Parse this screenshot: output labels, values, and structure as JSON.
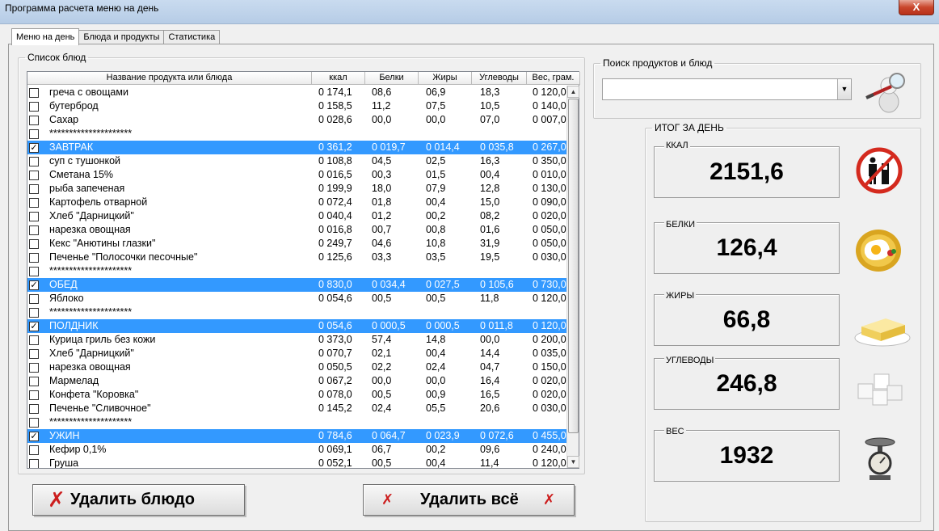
{
  "window": {
    "title": "Программа расчета меню на день",
    "close_label": "X"
  },
  "tabs": [
    {
      "label": "Меню на день"
    },
    {
      "label": "Блюда и продукты"
    },
    {
      "label": "Статистика"
    }
  ],
  "dish_list": {
    "group_title": "Список блюд",
    "columns": [
      "Название продукта или блюда",
      "ккал",
      "Белки",
      "Жиры",
      "Углеводы",
      "Вес, грам."
    ],
    "rows": [
      {
        "checked": false,
        "selected": false,
        "name": "греча с овощами",
        "kcal": "0 174,1",
        "protein": "08,6",
        "fat": "06,9",
        "carbs": "18,3",
        "weight": "0 120,0"
      },
      {
        "checked": false,
        "selected": false,
        "name": "бутерброд",
        "kcal": "0 158,5",
        "protein": "11,2",
        "fat": "07,5",
        "carbs": "10,5",
        "weight": "0 140,0"
      },
      {
        "checked": false,
        "selected": false,
        "name": "Сахар",
        "kcal": "0 028,6",
        "protein": "00,0",
        "fat": "00,0",
        "carbs": "07,0",
        "weight": "0 007,0"
      },
      {
        "checked": false,
        "selected": false,
        "name": "*********************",
        "kcal": "",
        "protein": "",
        "fat": "",
        "carbs": "",
        "weight": ""
      },
      {
        "checked": true,
        "selected": true,
        "name": "ЗАВТРАК",
        "kcal": "0 361,2",
        "protein": "0 019,7",
        "fat": "0 014,4",
        "carbs": "0 035,8",
        "weight": "0 267,0"
      },
      {
        "checked": false,
        "selected": false,
        "name": "суп с тушонкой",
        "kcal": "0 108,8",
        "protein": "04,5",
        "fat": "02,5",
        "carbs": "16,3",
        "weight": "0 350,0"
      },
      {
        "checked": false,
        "selected": false,
        "name": "Сметана 15%",
        "kcal": "0 016,5",
        "protein": "00,3",
        "fat": "01,5",
        "carbs": "00,4",
        "weight": "0 010,0"
      },
      {
        "checked": false,
        "selected": false,
        "name": "рыба запеченая",
        "kcal": "0 199,9",
        "protein": "18,0",
        "fat": "07,9",
        "carbs": "12,8",
        "weight": "0 130,0"
      },
      {
        "checked": false,
        "selected": false,
        "name": "Картофель отварной",
        "kcal": "0 072,4",
        "protein": "01,8",
        "fat": "00,4",
        "carbs": "15,0",
        "weight": "0 090,0"
      },
      {
        "checked": false,
        "selected": false,
        "name": "Хлеб \"Дарницкий\"",
        "kcal": "0 040,4",
        "protein": "01,2",
        "fat": "00,2",
        "carbs": "08,2",
        "weight": "0 020,0"
      },
      {
        "checked": false,
        "selected": false,
        "name": "нарезка овощная",
        "kcal": "0 016,8",
        "protein": "00,7",
        "fat": "00,8",
        "carbs": "01,6",
        "weight": "0 050,0"
      },
      {
        "checked": false,
        "selected": false,
        "name": "Кекс \"Анютины глазки\"",
        "kcal": "0 249,7",
        "protein": "04,6",
        "fat": "10,8",
        "carbs": "31,9",
        "weight": "0 050,0"
      },
      {
        "checked": false,
        "selected": false,
        "name": "Печенье \"Полосочки песочные\"",
        "kcal": "0 125,6",
        "protein": "03,3",
        "fat": "03,5",
        "carbs": "19,5",
        "weight": "0 030,0"
      },
      {
        "checked": false,
        "selected": false,
        "name": "*********************",
        "kcal": "",
        "protein": "",
        "fat": "",
        "carbs": "",
        "weight": ""
      },
      {
        "checked": true,
        "selected": true,
        "name": "ОБЕД",
        "kcal": "0 830,0",
        "protein": "0 034,4",
        "fat": "0 027,5",
        "carbs": "0 105,6",
        "weight": "0 730,0"
      },
      {
        "checked": false,
        "selected": false,
        "name": "Яблоко",
        "kcal": "0 054,6",
        "protein": "00,5",
        "fat": "00,5",
        "carbs": "11,8",
        "weight": "0 120,0"
      },
      {
        "checked": false,
        "selected": false,
        "name": "*********************",
        "kcal": "",
        "protein": "",
        "fat": "",
        "carbs": "",
        "weight": ""
      },
      {
        "checked": true,
        "selected": true,
        "name": "ПОЛДНИК",
        "kcal": "0 054,6",
        "protein": "0 000,5",
        "fat": "0 000,5",
        "carbs": "0 011,8",
        "weight": "0 120,0"
      },
      {
        "checked": false,
        "selected": false,
        "name": "Курица гриль без кожи",
        "kcal": "0 373,0",
        "protein": "57,4",
        "fat": "14,8",
        "carbs": "00,0",
        "weight": "0 200,0"
      },
      {
        "checked": false,
        "selected": false,
        "name": "Хлеб \"Дарницкий\"",
        "kcal": "0 070,7",
        "protein": "02,1",
        "fat": "00,4",
        "carbs": "14,4",
        "weight": "0 035,0"
      },
      {
        "checked": false,
        "selected": false,
        "name": "нарезка овощная",
        "kcal": "0 050,5",
        "protein": "02,2",
        "fat": "02,4",
        "carbs": "04,7",
        "weight": "0 150,0"
      },
      {
        "checked": false,
        "selected": false,
        "name": "Мармелад",
        "kcal": "0 067,2",
        "protein": "00,0",
        "fat": "00,0",
        "carbs": "16,4",
        "weight": "0 020,0"
      },
      {
        "checked": false,
        "selected": false,
        "name": "Конфета \"Коровка\"",
        "kcal": "0 078,0",
        "protein": "00,5",
        "fat": "00,9",
        "carbs": "16,5",
        "weight": "0 020,0"
      },
      {
        "checked": false,
        "selected": false,
        "name": "Печенье \"Сливочное\"",
        "kcal": "0 145,2",
        "protein": "02,4",
        "fat": "05,5",
        "carbs": "20,6",
        "weight": "0 030,0"
      },
      {
        "checked": false,
        "selected": false,
        "name": "*********************",
        "kcal": "",
        "protein": "",
        "fat": "",
        "carbs": "",
        "weight": ""
      },
      {
        "checked": true,
        "selected": true,
        "name": "УЖИН",
        "kcal": "0 784,6",
        "protein": "0 064,7",
        "fat": "0 023,9",
        "carbs": "0 072,6",
        "weight": "0 455,0"
      },
      {
        "checked": false,
        "selected": false,
        "name": "Кефир 0,1%",
        "kcal": "0 069,1",
        "protein": "06,7",
        "fat": "00,2",
        "carbs": "09,6",
        "weight": "0 240,0"
      },
      {
        "checked": false,
        "selected": false,
        "name": "Груша",
        "kcal": "0 052,1",
        "protein": "00,5",
        "fat": "00,4",
        "carbs": "11,4",
        "weight": "0 120,0"
      }
    ]
  },
  "buttons": {
    "delete_dish": "Удалить блюдо",
    "delete_all": "Удалить всё"
  },
  "search": {
    "group_title": "Поиск продуктов и блюд",
    "value": "",
    "placeholder": ""
  },
  "totals": {
    "group_title": "ИТОГ ЗА ДЕНЬ",
    "items": [
      {
        "label": "ККАЛ",
        "value": "2151,6",
        "icon": "calorie-icon"
      },
      {
        "label": "БЕЛКИ",
        "value": "126,4",
        "icon": "fried-egg-icon"
      },
      {
        "label": "ЖИРЫ",
        "value": "66,8",
        "icon": "butter-icon"
      },
      {
        "label": "УГЛЕВОДЫ",
        "value": "246,8",
        "icon": "sugar-cubes-icon"
      },
      {
        "label": "ВЕС",
        "value": "1932",
        "icon": "scale-icon"
      }
    ]
  },
  "colors": {
    "selection": "#3399ff",
    "delete_x": "#cc1d1d",
    "titlebar": "#c9dbef"
  }
}
